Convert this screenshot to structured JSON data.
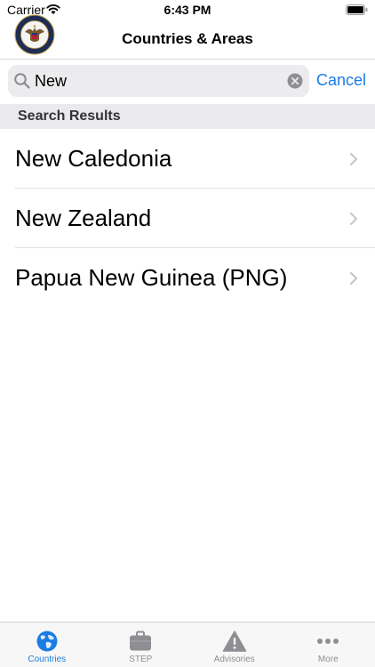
{
  "status_bar": {
    "carrier": "Carrier",
    "time": "6:43 PM"
  },
  "nav": {
    "title": "Countries & Areas"
  },
  "search": {
    "value": "New",
    "cancel_label": "Cancel"
  },
  "section": {
    "header": "Search Results"
  },
  "results": [
    {
      "label": "New Caledonia"
    },
    {
      "label": "New Zealand"
    },
    {
      "label": "Papua New Guinea (PNG)"
    }
  ],
  "tabs": [
    {
      "label": "Countries",
      "icon": "globe-icon",
      "active": true
    },
    {
      "label": "STEP",
      "icon": "briefcase-icon",
      "active": false
    },
    {
      "label": "Advisories",
      "icon": "warning-icon",
      "active": false
    },
    {
      "label": "More",
      "icon": "more-icon",
      "active": false
    }
  ],
  "colors": {
    "accent": "#1b7de3",
    "tab_inactive": "#8e8e93",
    "section_bg": "#e9e9ee",
    "search_bg": "#ececee"
  }
}
